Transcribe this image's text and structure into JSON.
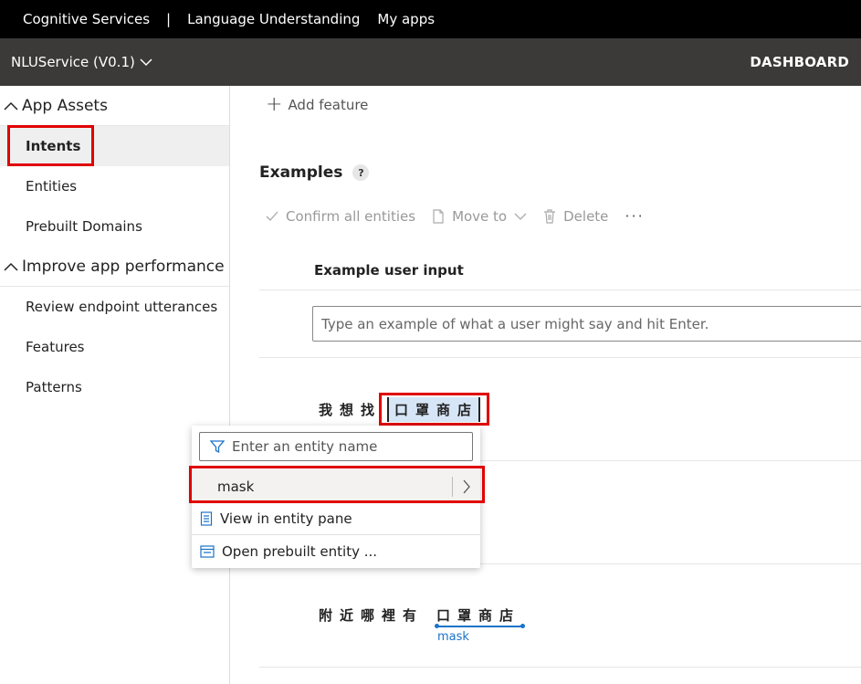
{
  "topbar": {
    "service": "Cognitive Services",
    "separator": "|",
    "product": "Language Understanding",
    "my_apps": "My apps"
  },
  "appbar": {
    "app_name": "NLUService (V0.1)",
    "dashboard": "DASHBOARD"
  },
  "sidebar": {
    "app_assets": "App Assets",
    "items_assets": [
      {
        "label": "Intents",
        "active": true
      },
      {
        "label": "Entities"
      },
      {
        "label": "Prebuilt Domains"
      }
    ],
    "improve": "Improve app performance",
    "items_improve": [
      {
        "label": "Review endpoint utterances"
      },
      {
        "label": "Features"
      },
      {
        "label": "Patterns"
      }
    ]
  },
  "main": {
    "add_feature": "Add feature",
    "examples_title": "Examples",
    "help": "?",
    "toolbar": {
      "confirm": "Confirm all entities",
      "move_to": "Move to",
      "delete": "Delete",
      "more": "···"
    },
    "column_header": "Example user input",
    "input_placeholder": "Type an example of what a user might say and hit Enter.",
    "utterance1_prefix": "我想找",
    "utterance1_selected": "口罩商店",
    "utterance2_prefix": "附近哪裡有",
    "utterance2_tagged": "口罩商店",
    "utterance2_entity": "mask"
  },
  "popup": {
    "filter_placeholder": "Enter an entity name",
    "entity": "mask",
    "view_in_pane": "View in entity pane",
    "open_prebuilt": "Open prebuilt entity ..."
  },
  "colors": {
    "highlight_red": "#e00000",
    "selection_blue": "#d7e6f7",
    "entity_blue": "#1a73c9"
  }
}
